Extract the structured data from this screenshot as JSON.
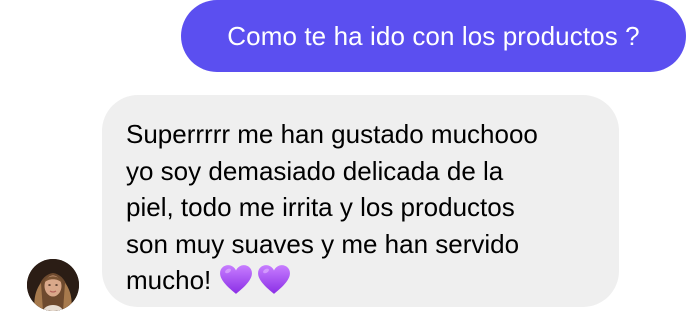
{
  "chat": {
    "outgoing_message": "Como te ha ido con los productos ?",
    "incoming_message": "Superrrrr me han gustado muchooo\nyo soy demasiado delicada de la\npiel, todo me irrita y los productos\nson muy suaves y me han servido\nmucho!",
    "incoming_emojis": [
      "purple-heart-icon",
      "purple-heart-icon"
    ]
  },
  "colors": {
    "outgoing_bubble": "#5b4ff0",
    "incoming_bubble": "#efefef",
    "heart": "#a855f7"
  }
}
